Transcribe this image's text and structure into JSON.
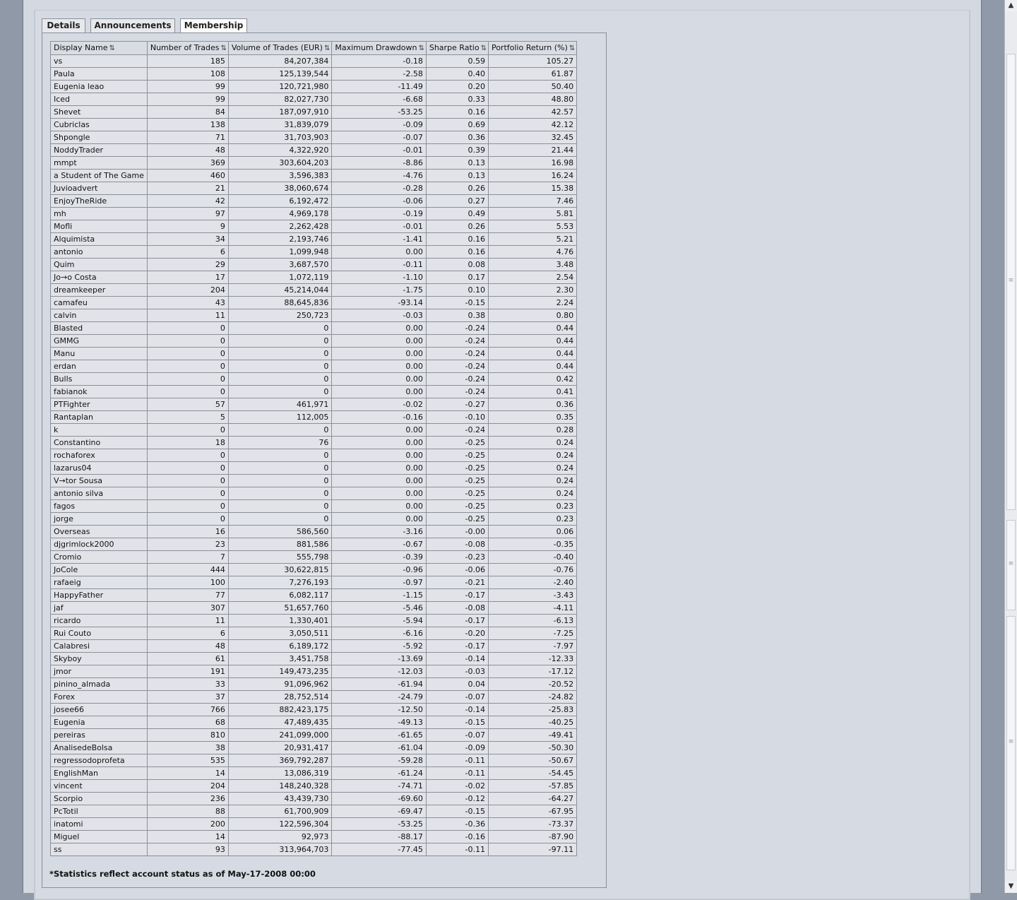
{
  "tabs": [
    {
      "label": "Details",
      "active": false
    },
    {
      "label": "Announcements",
      "active": false
    },
    {
      "label": "Membership",
      "active": true
    }
  ],
  "table": {
    "columns": [
      "Display Name",
      "Number of Trades",
      "Volume of Trades (EUR)",
      "Maximum Drawdown",
      "Sharpe Ratio",
      "Portfolio Return (%)"
    ],
    "sort_icon": "⇅",
    "rows": [
      [
        "vs",
        "185",
        "84,207,384",
        "-0.18",
        "0.59",
        "105.27"
      ],
      [
        "Paula",
        "108",
        "125,139,544",
        "-2.58",
        "0.40",
        "61.87"
      ],
      [
        "Eugenia leao",
        "99",
        "120,721,980",
        "-11.49",
        "0.20",
        "50.40"
      ],
      [
        "Iced",
        "99",
        "82,027,730",
        "-6.68",
        "0.33",
        "48.80"
      ],
      [
        "Shevet",
        "84",
        "187,097,910",
        "-53.25",
        "0.16",
        "42.57"
      ],
      [
        "Cubriclas",
        "138",
        "31,839,079",
        "-0.09",
        "0.69",
        "42.12"
      ],
      [
        "Shpongle",
        "71",
        "31,703,903",
        "-0.07",
        "0.36",
        "32.45"
      ],
      [
        "NoddyTrader",
        "48",
        "4,322,920",
        "-0.01",
        "0.39",
        "21.44"
      ],
      [
        "mmpt",
        "369",
        "303,604,203",
        "-8.86",
        "0.13",
        "16.98"
      ],
      [
        "a Student of The Game",
        "460",
        "3,596,383",
        "-4.76",
        "0.13",
        "16.24"
      ],
      [
        "Juvioadvert",
        "21",
        "38,060,674",
        "-0.28",
        "0.26",
        "15.38"
      ],
      [
        "EnjoyTheRide",
        "42",
        "6,192,472",
        "-0.06",
        "0.27",
        "7.46"
      ],
      [
        "mh",
        "97",
        "4,969,178",
        "-0.19",
        "0.49",
        "5.81"
      ],
      [
        "Mofli",
        "9",
        "2,262,428",
        "-0.01",
        "0.26",
        "5.53"
      ],
      [
        "Alquimista",
        "34",
        "2,193,746",
        "-1.41",
        "0.16",
        "5.21"
      ],
      [
        "antonio",
        "6",
        "1,099,948",
        "0.00",
        "0.16",
        "4.76"
      ],
      [
        "Quim",
        "29",
        "3,687,570",
        "-0.11",
        "0.08",
        "3.48"
      ],
      [
        "Jo→o Costa",
        "17",
        "1,072,119",
        "-1.10",
        "0.17",
        "2.54"
      ],
      [
        "dreamkeeper",
        "204",
        "45,214,044",
        "-1.75",
        "0.10",
        "2.30"
      ],
      [
        "camafeu",
        "43",
        "88,645,836",
        "-93.14",
        "-0.15",
        "2.24"
      ],
      [
        "calvin",
        "11",
        "250,723",
        "-0.03",
        "0.38",
        "0.80"
      ],
      [
        "Blasted",
        "0",
        "0",
        "0.00",
        "-0.24",
        "0.44"
      ],
      [
        "GMMG",
        "0",
        "0",
        "0.00",
        "-0.24",
        "0.44"
      ],
      [
        "Manu",
        "0",
        "0",
        "0.00",
        "-0.24",
        "0.44"
      ],
      [
        "erdan",
        "0",
        "0",
        "0.00",
        "-0.24",
        "0.44"
      ],
      [
        "Bulls",
        "0",
        "0",
        "0.00",
        "-0.24",
        "0.42"
      ],
      [
        "fabianok",
        "0",
        "0",
        "0.00",
        "-0.24",
        "0.41"
      ],
      [
        "PTFighter",
        "57",
        "461,971",
        "-0.02",
        "-0.27",
        "0.36"
      ],
      [
        "Rantaplan",
        "5",
        "112,005",
        "-0.16",
        "-0.10",
        "0.35"
      ],
      [
        "k",
        "0",
        "0",
        "0.00",
        "-0.24",
        "0.28"
      ],
      [
        "Constantino",
        "18",
        "76",
        "0.00",
        "-0.25",
        "0.24"
      ],
      [
        "rochaforex",
        "0",
        "0",
        "0.00",
        "-0.25",
        "0.24"
      ],
      [
        "lazarus04",
        "0",
        "0",
        "0.00",
        "-0.25",
        "0.24"
      ],
      [
        "V→tor Sousa",
        "0",
        "0",
        "0.00",
        "-0.25",
        "0.24"
      ],
      [
        "antonio silva",
        "0",
        "0",
        "0.00",
        "-0.25",
        "0.24"
      ],
      [
        "fagos",
        "0",
        "0",
        "0.00",
        "-0.25",
        "0.23"
      ],
      [
        "jorge",
        "0",
        "0",
        "0.00",
        "-0.25",
        "0.23"
      ],
      [
        "Overseas",
        "16",
        "586,560",
        "-3.16",
        "-0.00",
        "0.06"
      ],
      [
        "djgrimlock2000",
        "23",
        "881,586",
        "-0.67",
        "-0.08",
        "-0.35"
      ],
      [
        "Cromio",
        "7",
        "555,798",
        "-0.39",
        "-0.23",
        "-0.40"
      ],
      [
        "JoCole",
        "444",
        "30,622,815",
        "-0.96",
        "-0.06",
        "-0.76"
      ],
      [
        "rafaeig",
        "100",
        "7,276,193",
        "-0.97",
        "-0.21",
        "-2.40"
      ],
      [
        "HappyFather",
        "77",
        "6,082,117",
        "-1.15",
        "-0.17",
        "-3.43"
      ],
      [
        "jaf",
        "307",
        "51,657,760",
        "-5.46",
        "-0.08",
        "-4.11"
      ],
      [
        "ricardo",
        "11",
        "1,330,401",
        "-5.94",
        "-0.17",
        "-6.13"
      ],
      [
        "Rui Couto",
        "6",
        "3,050,511",
        "-6.16",
        "-0.20",
        "-7.25"
      ],
      [
        "Calabresi",
        "48",
        "6,189,172",
        "-5.92",
        "-0.17",
        "-7.97"
      ],
      [
        "Skyboy",
        "61",
        "3,451,758",
        "-13.69",
        "-0.14",
        "-12.33"
      ],
      [
        "jmor",
        "191",
        "149,473,235",
        "-12.03",
        "-0.03",
        "-17.12"
      ],
      [
        "pinino_almada",
        "33",
        "91,096,962",
        "-61.94",
        "0.04",
        "-20.52"
      ],
      [
        "Forex",
        "37",
        "28,752,514",
        "-24.79",
        "-0.07",
        "-24.82"
      ],
      [
        "josee66",
        "766",
        "882,423,175",
        "-12.50",
        "-0.14",
        "-25.83"
      ],
      [
        "Eugenia",
        "68",
        "47,489,435",
        "-49.13",
        "-0.15",
        "-40.25"
      ],
      [
        "pereiras",
        "810",
        "241,099,000",
        "-61.65",
        "-0.07",
        "-49.41"
      ],
      [
        "AnalisedeBolsa",
        "38",
        "20,931,417",
        "-61.04",
        "-0.09",
        "-50.30"
      ],
      [
        "regressodoprofeta",
        "535",
        "369,792,287",
        "-59.28",
        "-0.11",
        "-50.67"
      ],
      [
        "EnglishMan",
        "14",
        "13,086,319",
        "-61.24",
        "-0.11",
        "-54.45"
      ],
      [
        "vincent",
        "204",
        "148,240,328",
        "-74.71",
        "-0.02",
        "-57.85"
      ],
      [
        "Scorpio",
        "236",
        "43,439,730",
        "-69.60",
        "-0.12",
        "-64.27"
      ],
      [
        "PcTotil",
        "88",
        "61,700,909",
        "-69.47",
        "-0.15",
        "-67.95"
      ],
      [
        "inatomi",
        "200",
        "122,596,304",
        "-53.25",
        "-0.36",
        "-73.37"
      ],
      [
        "Miguel",
        "14",
        "92,973",
        "-88.17",
        "-0.16",
        "-87.90"
      ],
      [
        "ss",
        "93",
        "313,964,703",
        "-77.45",
        "-0.11",
        "-97.11"
      ]
    ]
  },
  "footnote": "*Statistics reflect account status as of May-17-2008 00:00",
  "scrollbar": {
    "up_arrow": "▲",
    "down_arrow": "▼",
    "grip": "≡"
  }
}
